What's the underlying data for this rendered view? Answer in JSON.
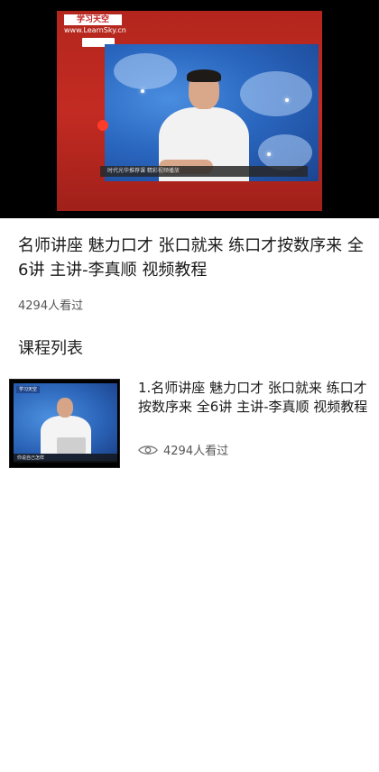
{
  "player": {
    "logo_text": "学习天空",
    "logo_url": "www.LearnSky.cn",
    "caption": "时代光华推荐课  精彩视频播放"
  },
  "course": {
    "title": "名师讲座 魅力口才 张口就来 练口才按数序来 全6讲 主讲-李真顺 视频教程",
    "views": "4294人看过"
  },
  "list": {
    "heading": "课程列表",
    "items": [
      {
        "thumb_logo": "学习天空",
        "thumb_caption": "你说自己怎样",
        "title": "1.名师讲座 魅力口才 张口就来 练口才按数序来 全6讲 主讲-李真顺 视频教程",
        "views": "4294人看过"
      }
    ]
  },
  "icons": {
    "views": "eye-icon"
  },
  "colors": {
    "frame_red": "#c32b22",
    "text_primary": "#1a1a1a",
    "text_secondary": "#555555"
  }
}
